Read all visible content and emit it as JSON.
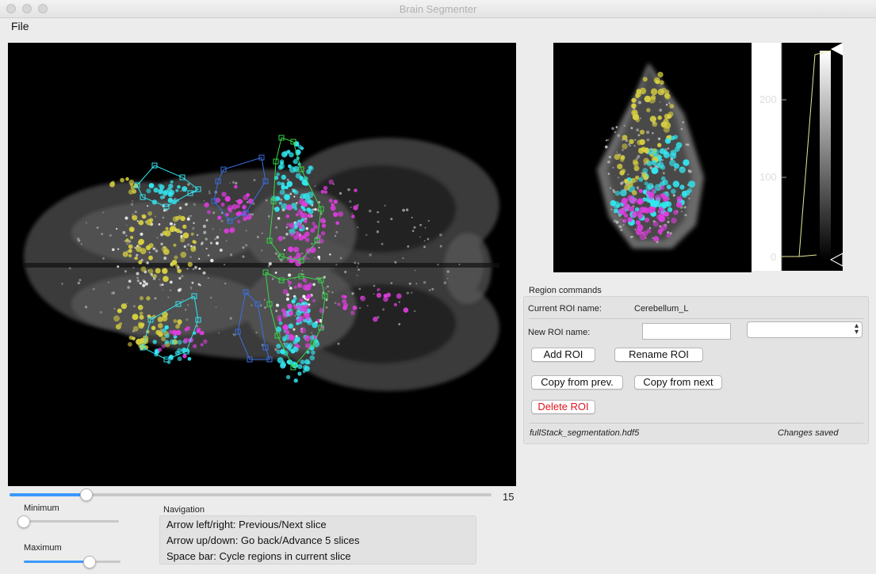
{
  "window": {
    "title": "Brain Segmenter"
  },
  "menu": {
    "file": "File"
  },
  "slice": {
    "value": "15",
    "position_fraction": 0.16
  },
  "contrast": {
    "minimum_label": "Minimum",
    "maximum_label": "Maximum",
    "minimum_fraction": 0.0,
    "maximum_fraction": 0.68
  },
  "navigation": {
    "title": "Navigation",
    "lines": [
      "Arrow left/right: Previous/Next slice",
      "Arrow up/down: Go back/Advance 5 slices",
      "Space bar: Cycle regions in current slice"
    ]
  },
  "histogram": {
    "ticks": [
      "200",
      "100",
      "0"
    ]
  },
  "region": {
    "title": "Region commands",
    "current_label": "Current ROI name:",
    "current_value": "Cerebellum_L",
    "new_label": "New ROI name:",
    "new_value": "",
    "dropdown_value": "",
    "add_button": "Add ROI",
    "rename_button": "Rename ROI",
    "copy_prev_button": "Copy from prev.",
    "copy_next_button": "Copy from next",
    "delete_button": "Delete ROI",
    "filename": "fullStack_segmentation.hdf5",
    "status": "Changes saved"
  },
  "colors": {
    "slider_accent": "#3b99fc",
    "roi_cyan": "#33e6f0",
    "roi_magenta": "#e03ce0",
    "roi_yellow": "#d8d040",
    "outline_green": "#39d84a",
    "outline_blue": "#3b6fe0",
    "delete_text": "#e0141e"
  },
  "icons": {
    "window_controls": "traffic-light-icons",
    "combo": "updown-chevron-icon",
    "histogram_marker": "triangle-marker-icon"
  }
}
